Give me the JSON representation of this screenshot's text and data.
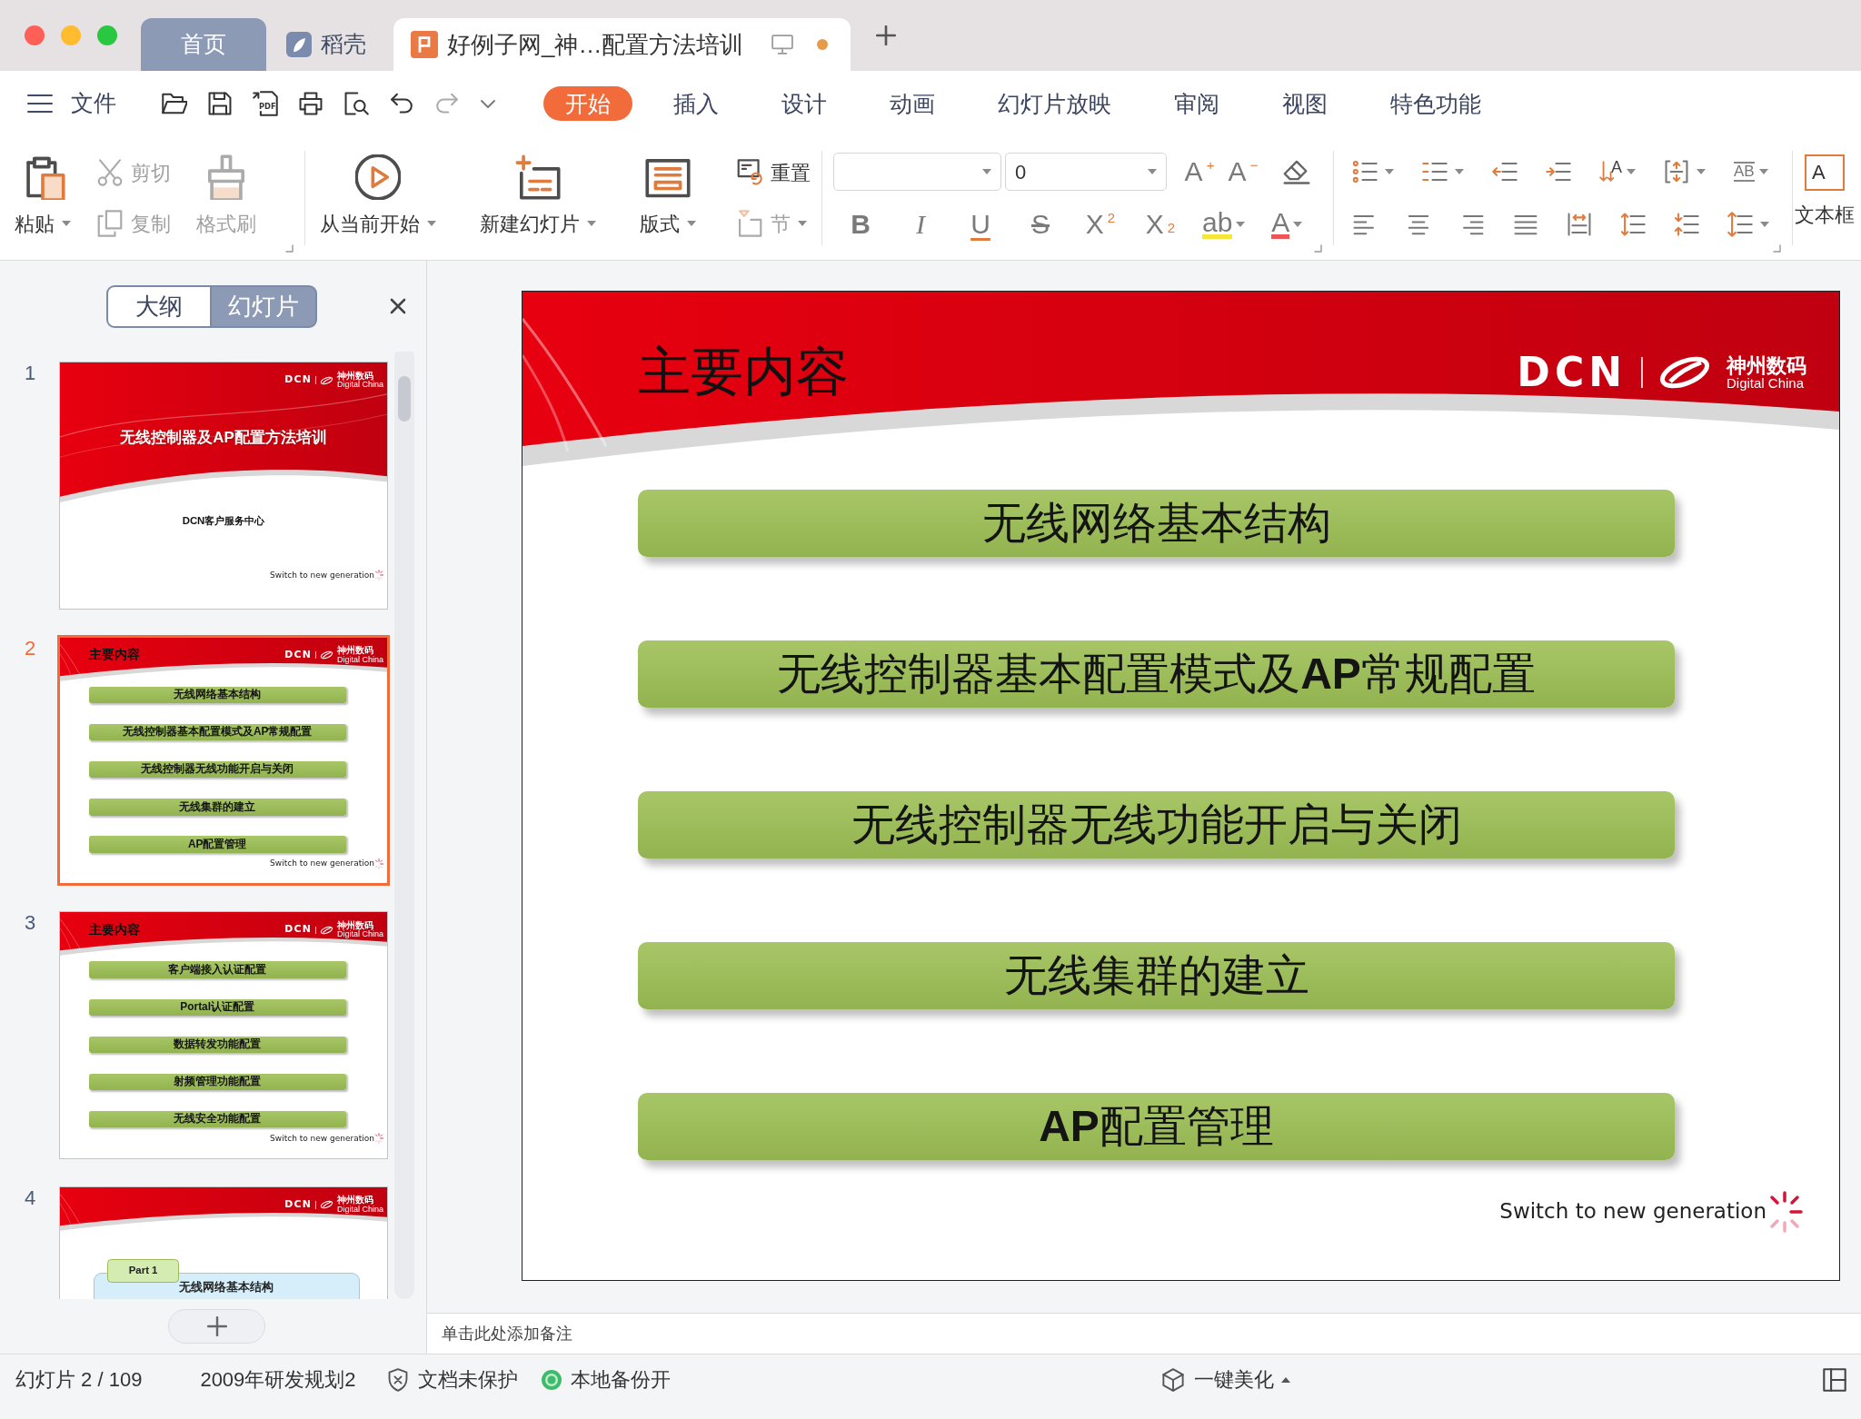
{
  "window": {
    "tabs": [
      {
        "kind": "home",
        "label": "首页",
        "selected": false
      },
      {
        "kind": "docer",
        "label": "稻壳",
        "selected": false
      },
      {
        "kind": "document",
        "label": "好例子网_神…配置方法培训",
        "selected": true,
        "modified": true
      }
    ]
  },
  "menu": {
    "file": "文件",
    "quick_access": [
      {
        "kind": "open",
        "disabled": false
      },
      {
        "kind": "save",
        "disabled": false
      },
      {
        "kind": "pdf",
        "text": "PDF",
        "disabled": false
      },
      {
        "kind": "print",
        "disabled": false
      },
      {
        "kind": "preview",
        "disabled": false
      },
      {
        "kind": "undo",
        "disabled": false
      },
      {
        "kind": "redo",
        "disabled": true
      }
    ],
    "tabs": [
      {
        "label": "开始",
        "selected": true
      },
      {
        "label": "插入",
        "selected": false
      },
      {
        "label": "设计",
        "selected": false
      },
      {
        "label": "动画",
        "selected": false
      },
      {
        "label": "幻灯片放映",
        "selected": false
      },
      {
        "label": "审阅",
        "selected": false
      },
      {
        "label": "视图",
        "selected": false
      },
      {
        "label": "特色功能",
        "selected": false
      }
    ]
  },
  "ribbon": {
    "clipboard": [
      {
        "kind": "paste",
        "label": "粘贴",
        "disabled": false
      },
      {
        "kind": "cut",
        "label": "剪切",
        "disabled": true
      },
      {
        "kind": "copy",
        "label": "复制",
        "disabled": true
      },
      {
        "kind": "format_painter",
        "label": "格式刷",
        "disabled": true
      }
    ],
    "slides": [
      {
        "kind": "play",
        "label": "从当前开始",
        "disabled": false
      },
      {
        "kind": "new_slide",
        "label": "新建幻灯片",
        "disabled": false
      },
      {
        "kind": "layout",
        "label": "版式",
        "disabled": false
      },
      {
        "kind": "reset",
        "label": "重置",
        "disabled": false
      },
      {
        "kind": "section",
        "label": "节",
        "disabled": true
      }
    ],
    "font": {
      "size": "0",
      "size_buttons": [
        "A$^{+}$",
        "A$^{−}$"
      ],
      "format_buttons": [
        "B",
        "I",
        "U",
        "S",
        "X$^{2}$",
        "X$_{2}$"
      ],
      "highlight": "ab",
      "font_color": "A"
    },
    "paragraph": {
      "text_direction": "A",
      "text_fit": "AB"
    },
    "textbox": {
      "icon_text": "A",
      "label": "文本框"
    }
  },
  "slides_panel": {
    "views": [
      {
        "label": "大纲",
        "selected": false
      },
      {
        "label": "幻灯片",
        "selected": true
      }
    ],
    "thumbnails": [
      {
        "number": "1",
        "selected": false,
        "kind": "title",
        "logo": {
          "brand": "DCN",
          "name_cn": "神州数码",
          "name_en": "Digital China"
        },
        "title": "无线控制器及AP配置方法培训",
        "subtitle": "DCN客户服务中心",
        "tagline": "Switch to new generation"
      },
      {
        "number": "2",
        "selected": true,
        "kind": "agenda",
        "title": "主要内容",
        "logo": {
          "brand": "DCN",
          "name_cn": "神州数码",
          "name_en": "Digital China"
        },
        "items": [
          "无线网络基本结构",
          "无线控制器基本配置模式及AP常规配置",
          "无线控制器无线功能开启与关闭",
          "无线集群的建立",
          "AP配置管理"
        ],
        "tagline": "Switch to new generation"
      },
      {
        "number": "3",
        "selected": false,
        "kind": "agenda",
        "title": "主要内容",
        "logo": {
          "brand": "DCN",
          "name_cn": "神州数码",
          "name_en": "Digital China"
        },
        "items": [
          "客户端接入认证配置",
          "Portal认证配置",
          "数据转发功能配置",
          "射频管理功能配置",
          "无线安全功能配置"
        ],
        "tagline": "Switch to new generation"
      },
      {
        "number": "4",
        "selected": false,
        "kind": "part",
        "logo": {
          "brand": "DCN",
          "name_cn": "神州数码",
          "name_en": "Digital China"
        },
        "badge": "Part 1",
        "title": "无线网络基本结构"
      }
    ]
  },
  "slide": {
    "kind": "agenda",
    "title": "主要内容",
    "logo": {
      "brand": "DCN",
      "name_cn": "神州数码",
      "name_en": "Digital China"
    },
    "items": [
      "无线网络基本结构",
      "无线控制器基本配置模式及**AP**常规配置",
      "无线控制器无线功能开启与关闭",
      "无线集群的建立",
      "**AP**配置管理"
    ],
    "tagline": "Switch to new generation"
  },
  "notes": {
    "placeholder": "单击此处添加备注"
  },
  "status_bar": {
    "slide_counter": "幻灯片 2 / 109",
    "template": "2009年研发规划2",
    "protection": "文档未保护",
    "backup": "本地备份开",
    "beautify": "一键美化"
  }
}
